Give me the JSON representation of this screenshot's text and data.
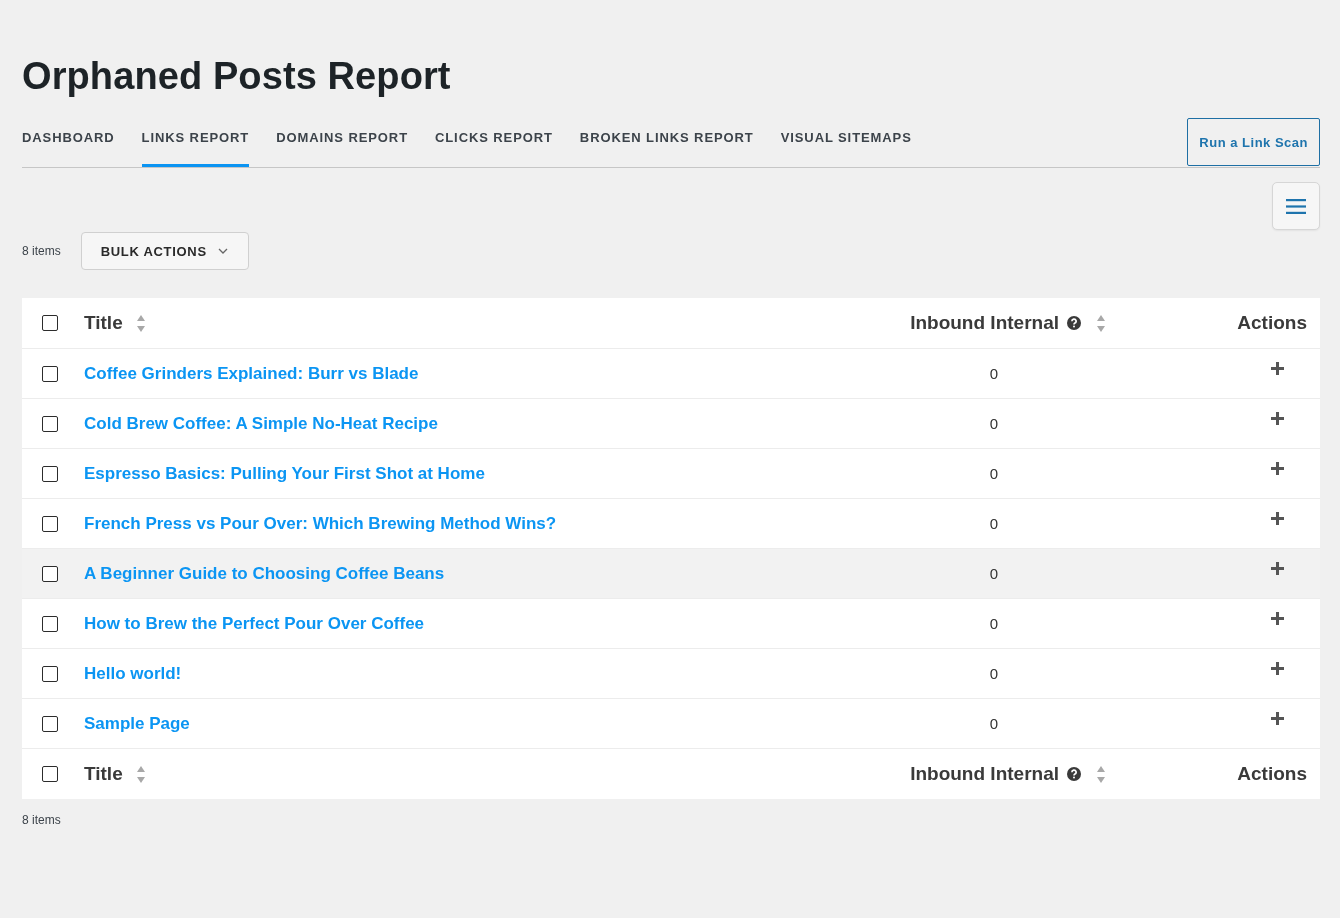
{
  "page": {
    "title": "Orphaned Posts Report"
  },
  "tabs": [
    {
      "label": "DASHBOARD",
      "selected": false
    },
    {
      "label": "LINKS REPORT",
      "selected": true
    },
    {
      "label": "DOMAINS REPORT",
      "selected": false
    },
    {
      "label": "CLICKS REPORT",
      "selected": false
    },
    {
      "label": "BROKEN LINKS REPORT",
      "selected": false
    },
    {
      "label": "VISUAL SITEMAPS",
      "selected": false
    }
  ],
  "scan_button": {
    "label": "Run a Link Scan"
  },
  "toolbar": {
    "item_count": "8 items",
    "bulk_actions": {
      "label": "BULK ACTIONS"
    }
  },
  "table": {
    "header": {
      "checked": false,
      "columns": [
        {
          "label": "Title",
          "sortable": true,
          "help": false
        },
        {
          "label": "Inbound Internal",
          "sortable": true,
          "help": true
        },
        {
          "label": "Actions",
          "sortable": false,
          "help": false
        }
      ]
    },
    "rows": [
      {
        "title": "Coffee Grinders Explained: Burr vs Blade",
        "inbound_internal": "0",
        "checked": false,
        "hovered": false
      },
      {
        "title": "Cold Brew Coffee: A Simple No-Heat Recipe",
        "inbound_internal": "0",
        "checked": false,
        "hovered": false
      },
      {
        "title": "Espresso Basics: Pulling Your First Shot at Home",
        "inbound_internal": "0",
        "checked": false,
        "hovered": false
      },
      {
        "title": "French Press vs Pour Over: Which Brewing Method Wins?",
        "inbound_internal": "0",
        "checked": false,
        "hovered": false
      },
      {
        "title": "A Beginner Guide to Choosing Coffee Beans",
        "inbound_internal": "0",
        "checked": false,
        "hovered": true
      },
      {
        "title": "How to Brew the Perfect Pour Over Coffee",
        "inbound_internal": "0",
        "checked": false,
        "hovered": false
      },
      {
        "title": "Hello world!",
        "inbound_internal": "0",
        "checked": false,
        "hovered": false
      },
      {
        "title": "Sample Page",
        "inbound_internal": "0",
        "checked": false,
        "hovered": false
      }
    ],
    "footer": {
      "checked": false,
      "columns": [
        {
          "label": "Title",
          "sortable": true,
          "help": false
        },
        {
          "label": "Inbound Internal",
          "sortable": true,
          "help": true
        },
        {
          "label": "Actions",
          "sortable": false,
          "help": false
        }
      ]
    }
  },
  "footer": {
    "item_count": "8 items"
  }
}
